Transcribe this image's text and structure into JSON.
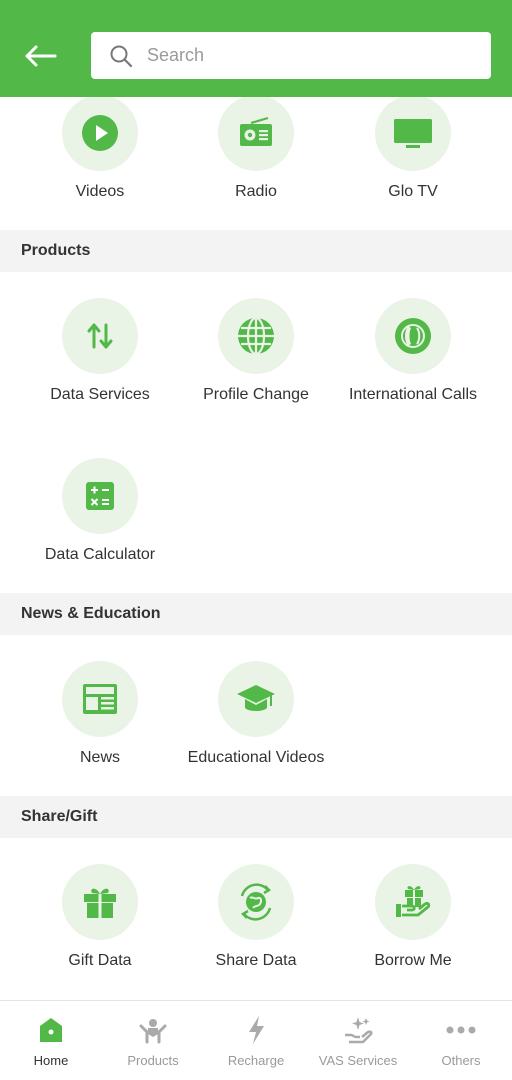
{
  "header": {
    "search_placeholder": "Search"
  },
  "colors": {
    "brand": "#52b848",
    "circle_bg": "#eaf4e6",
    "section_bg": "#f3f3f3"
  },
  "top_items": [
    {
      "label": "Videos",
      "icon": "play-icon"
    },
    {
      "label": "Radio",
      "icon": "radio-icon"
    },
    {
      "label": "Glo TV",
      "icon": "tv-icon"
    }
  ],
  "sections": [
    {
      "title": "Products",
      "items": [
        {
          "label": "Data Services",
          "icon": "arrows-updown-icon"
        },
        {
          "label": "Profile Change",
          "icon": "globe-icon"
        },
        {
          "label": "International Calls",
          "icon": "international-call-icon"
        },
        {
          "label": "Data Calculator",
          "icon": "calculator-icon"
        }
      ]
    },
    {
      "title": "News & Education",
      "items": [
        {
          "label": "News",
          "icon": "newspaper-icon"
        },
        {
          "label": "Educational Videos",
          "icon": "graduation-cap-icon"
        }
      ]
    },
    {
      "title": "Share/Gift",
      "items": [
        {
          "label": "Gift Data",
          "icon": "gift-icon"
        },
        {
          "label": "Share Data",
          "icon": "share-globe-icon"
        },
        {
          "label": "Borrow Me",
          "icon": "borrow-gift-icon"
        }
      ]
    }
  ],
  "bottom_nav": [
    {
      "label": "Home",
      "icon": "home-icon",
      "active": true
    },
    {
      "label": "Products",
      "icon": "products-icon",
      "active": false
    },
    {
      "label": "Recharge",
      "icon": "lightning-icon",
      "active": false
    },
    {
      "label": "VAS Services",
      "icon": "vas-icon",
      "active": false
    },
    {
      "label": "Others",
      "icon": "more-dots-icon",
      "active": false
    }
  ]
}
